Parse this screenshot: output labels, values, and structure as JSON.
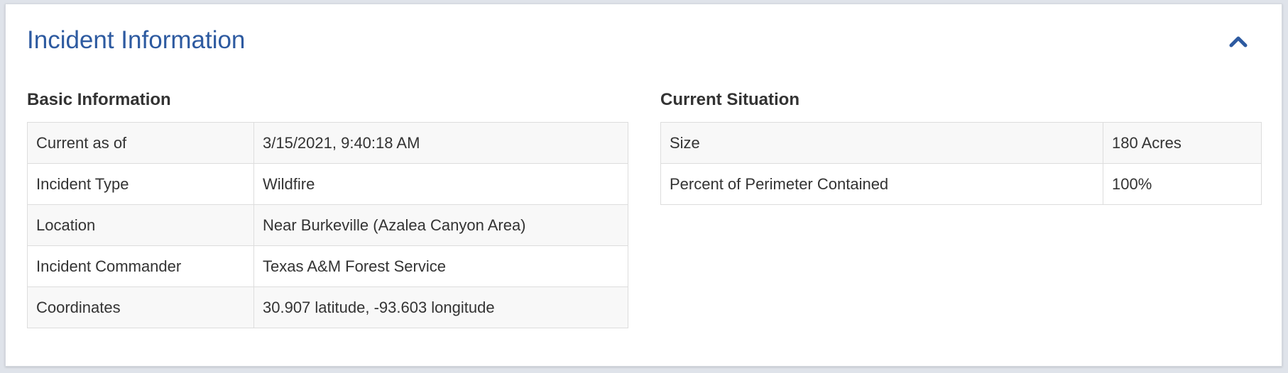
{
  "panel": {
    "title": "Incident Information",
    "accent_color": "#2d5aa0",
    "collapse_icon": "chevron-up-icon"
  },
  "basic_information": {
    "heading": "Basic Information",
    "rows": [
      {
        "label": "Current as of",
        "value": "3/15/2021, 9:40:18 AM"
      },
      {
        "label": "Incident Type",
        "value": "Wildfire"
      },
      {
        "label": "Location",
        "value": "Near Burkeville (Azalea Canyon Area)"
      },
      {
        "label": "Incident Commander",
        "value": "Texas A&M Forest Service"
      },
      {
        "label": "Coordinates",
        "value": "30.907 latitude, -93.603 longitude"
      }
    ]
  },
  "current_situation": {
    "heading": "Current Situation",
    "rows": [
      {
        "label": "Size",
        "value": "180 Acres"
      },
      {
        "label": "Percent of Perimeter Contained",
        "value": "100%"
      }
    ]
  }
}
